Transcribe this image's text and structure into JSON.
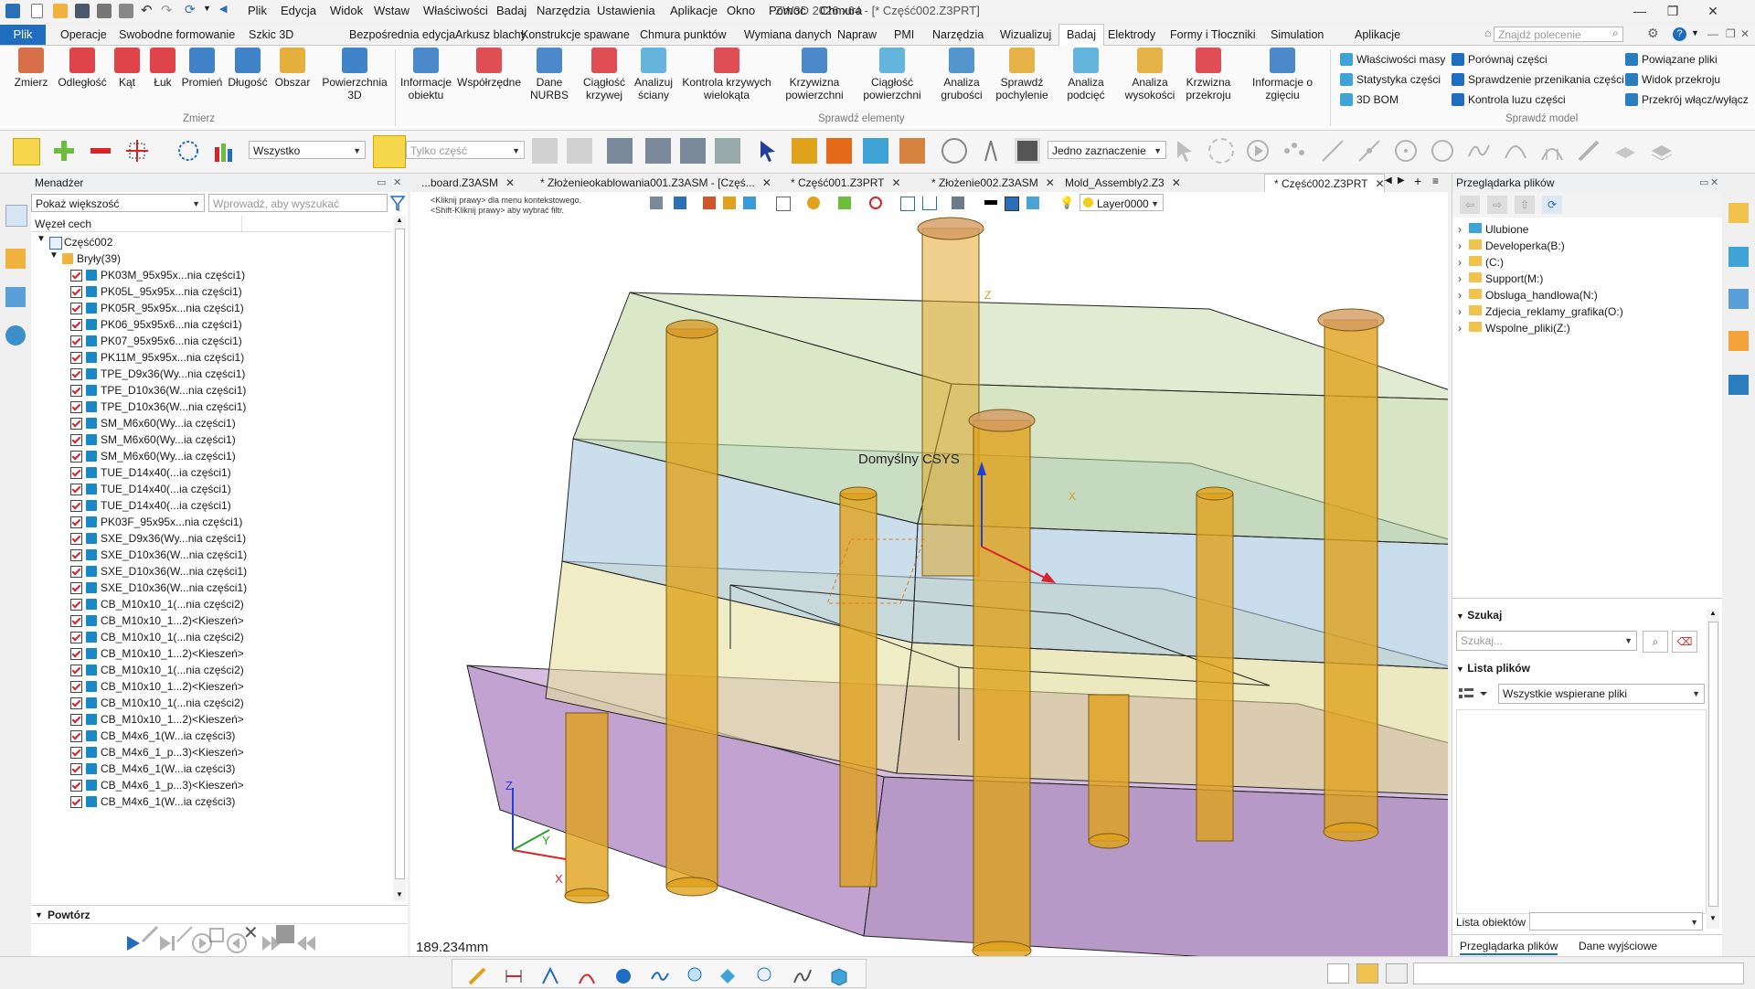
{
  "app": {
    "window_title": "ZW3D 2026 x64 - [* Część002.Z3PRT]",
    "menu": [
      "Plik",
      "Edycja",
      "Widok",
      "Wstaw",
      "Właściwości",
      "Badaj",
      "Narzędzia",
      "Ustawienia",
      "Aplikacje",
      "Okno",
      "Pomoc",
      "Chmura"
    ]
  },
  "ribbon_tabs": {
    "file": "Plik",
    "items": [
      "Operacje",
      "Swobodne formowanie",
      "Szkic 3D",
      "Bezpośrednia edycja",
      "Arkusz blachy",
      "Konstrukcje spawane",
      "Chmura punktów",
      "Wymiana danych",
      "Napraw",
      "PMI",
      "Narzędzia",
      "Wizualizuj",
      "Badaj",
      "Elektrody",
      "Formy i Tłoczniki",
      "Simulation",
      "Aplikacje"
    ],
    "active": "Badaj",
    "command_search_placeholder": "Znajdź polecenie"
  },
  "ribbon": {
    "measure_group": "Zmierz",
    "check_group": "Sprawdź elementy",
    "compare_group": "Sprawdź model",
    "measure_buttons": [
      "Zmierz",
      "Odległość",
      "Kąt",
      "Łuk",
      "Promień",
      "Długość",
      "Obszar",
      "Powierzchnia 3D"
    ],
    "check_buttons": [
      "Informacje obiektu",
      "Współrzędne",
      "Dane NURBS",
      "Ciągłość krzywej",
      "Analizuj ściany",
      "Kontrola krzywych wielokąta",
      "Krzywizna powierzchni",
      "Ciągłość powierzchni",
      "Analiza grubości",
      "Sprawdź pochylenie",
      "Analiza podcięć",
      "Analiza wysokości",
      "Krzwizna przekroju",
      "Informacje o zgięciu"
    ],
    "small_col1": [
      "Właściwości masy",
      "Statystyka części",
      "3D BOM"
    ],
    "small_col2": [
      "Porównaj części",
      "Sprawdzenie przenikania części",
      "Kontrola luzu części"
    ],
    "small_col3": [
      "Powiązane pliki",
      "Widok przekroju",
      "Przekrój włącz/wyłącz"
    ]
  },
  "toolbar": {
    "filter_value": "Wszystko",
    "part_filter_value": "Tylko część",
    "selection_mode": "Jedno zaznaczenie",
    "layer": "Layer0000"
  },
  "manager": {
    "title": "Menadżer",
    "show_more": "Pokaż większość",
    "search_placeholder": "Wprowadź, aby wyszukać",
    "column_header": "Węzeł cech",
    "root": "Część002",
    "bodies_node": "Bryły(39)",
    "items": [
      "PK03M_95x95x...nia części1)",
      "PK05L_95x95x...nia części1)",
      "PK05R_95x95x...nia części1)",
      "PK06_95x95x6...nia części1)",
      "PK07_95x95x6...nia części1)",
      "PK11M_95x95x...nia części1)",
      "TPE_D9x36(Wy...nia części1)",
      "TPE_D10x36(W...nia części1)",
      "TPE_D10x36(W...nia części1)",
      "SM_M6x60(Wy...ia części1)",
      "SM_M6x60(Wy...ia części1)",
      "SM_M6x60(Wy...ia części1)",
      "TUE_D14x40(...ia części1)",
      "TUE_D14x40(...ia części1)",
      "TUE_D14x40(...ia części1)",
      "PK03F_95x95x...nia części1)",
      "SXE_D9x36(Wy...nia części1)",
      "SXE_D10x36(W...nia części1)",
      "SXE_D10x36(W...nia części1)",
      "SXE_D10x36(W...nia części1)",
      "CB_M10x10_1(...nia części2)",
      "CB_M10x10_1...2)<Kieszeń>",
      "CB_M10x10_1(...nia części2)",
      "CB_M10x10_1...2)<Kieszeń>",
      "CB_M10x10_1(...nia części2)",
      "CB_M10x10_1...2)<Kieszeń>",
      "CB_M10x10_1(...nia części2)",
      "CB_M10x10_1...2)<Kieszeń>",
      "CB_M4x6_1(W...ia części3)",
      "CB_M4x6_1_p...3)<Kieszeń>",
      "CB_M4x6_1(W...ia części3)",
      "CB_M4x6_1_p...3)<Kieszeń>",
      "CB_M4x6_1(W...ia części3)"
    ],
    "replay_title": "Powtórz"
  },
  "doc_tabs": [
    {
      "label": "...board.Z3ASM",
      "active": false
    },
    {
      "label": "* Złożenieokablowania001.Z3ASM - [Częś...",
      "active": false
    },
    {
      "label": "* Część001.Z3PRT",
      "active": false
    },
    {
      "label": "* Złożenie002.Z3ASM",
      "active": false
    },
    {
      "label": "Mold_Assembly2.Z3",
      "active": false
    },
    {
      "label": "* Część002.Z3PRT",
      "active": true
    }
  ],
  "viewport": {
    "hint1": "<Kliknij prawy> dla menu kontekstowego.",
    "hint2": "<Shift-Kliknij prawy> aby wybrać filtr.",
    "csys_label": "Domyślny CSYS",
    "measure_readout": "189.234mm",
    "axis_x": "X",
    "axis_y": "Y",
    "axis_z": "Z"
  },
  "file_browser": {
    "title": "Przeglądarka plików",
    "tree": [
      "Ulubione",
      "Developerka(B:)",
      "(C:)",
      "Support(M:)",
      "Obsluga_handlowa(N:)",
      "Zdjecia_reklamy_grafika(O:)",
      "Wspolne_pliki(Z:)"
    ],
    "search_section": "Szukaj",
    "search_placeholder": "Szukaj...",
    "file_list_section": "Lista plików",
    "file_type_filter": "Wszystkie wspierane pliki",
    "object_list_label": "Lista obiektów",
    "bottom_tabs": [
      "Przeglądarka plików",
      "Dane wyjściowe"
    ]
  },
  "colors": {
    "accent": "#1f6dbf",
    "cube_blue": "#1a87c7",
    "pin_orange": "#e0a11c",
    "plate_purple": "#c9a8d6",
    "plate_green": "#cfe0b8",
    "plate_blue": "#b9d3e6",
    "plate_yellow": "#ece9b5"
  }
}
